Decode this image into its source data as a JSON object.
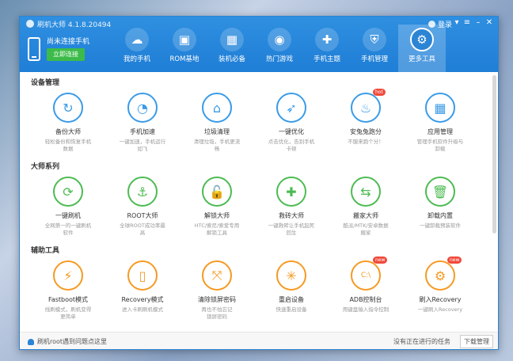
{
  "window": {
    "title": "刷机大师 4.1.8.20494",
    "login": "登录"
  },
  "phone": {
    "status": "尚未连接手机",
    "connect_label": "立即连接"
  },
  "nav": [
    {
      "label": "我的手机",
      "icon": "cloud-icon",
      "color": "#4aa3e8"
    },
    {
      "label": "ROM基地",
      "icon": "shopping-bag-icon",
      "color": "#ffffff"
    },
    {
      "label": "装机必备",
      "icon": "picture-icon",
      "color": "#f0a030"
    },
    {
      "label": "热门游戏",
      "icon": "gamepad-icon",
      "color": "#f58a1f"
    },
    {
      "label": "手机主题",
      "icon": "tshirt-icon",
      "color": "#e8453c"
    },
    {
      "label": "手机管理",
      "icon": "shield-icon",
      "color": "#3db14e"
    },
    {
      "label": "更多工具",
      "icon": "tools-icon",
      "color": "#2b84d4"
    }
  ],
  "sections": [
    {
      "title": "设备管理",
      "tools": [
        {
          "name": "备份大师",
          "desc1": "轻松备份和恢复手机",
          "desc2": "数据",
          "icon": "backup-icon",
          "badge": ""
        },
        {
          "name": "手机加速",
          "desc1": "一键加速，手机运行",
          "desc2": "如飞",
          "icon": "speedometer-icon",
          "badge": ""
        },
        {
          "name": "垃圾清理",
          "desc1": "清理垃圾，手机更流",
          "desc2": "畅",
          "icon": "broom-icon",
          "badge": ""
        },
        {
          "name": "一键优化",
          "desc1": "点击优化，告别手机",
          "desc2": "卡顿",
          "icon": "rocket-icon",
          "badge": ""
        },
        {
          "name": "安兔兔跑分",
          "desc1": "不服来跑个分！",
          "desc2": "",
          "icon": "antutu-icon",
          "badge": "hot"
        },
        {
          "name": "应用管理",
          "desc1": "管理手机软件升级与",
          "desc2": "卸载",
          "icon": "apps-icon",
          "badge": ""
        }
      ]
    },
    {
      "title": "大师系列",
      "tools": [
        {
          "name": "一键刷机",
          "desc1": "全网第一的一键刷机",
          "desc2": "软件",
          "icon": "refresh-icon",
          "badge": ""
        },
        {
          "name": "ROOT大师",
          "desc1": "全球ROOT成功率最",
          "desc2": "高",
          "icon": "anchor-icon",
          "badge": ""
        },
        {
          "name": "解锁大师",
          "desc1": "HTC/索尼/索爱专用",
          "desc2": "解锁工具",
          "icon": "unlock-icon",
          "badge": ""
        },
        {
          "name": "救砖大师",
          "desc1": "一键救砖让手机起死",
          "desc2": "回生",
          "icon": "phone-rescue-icon",
          "badge": ""
        },
        {
          "name": "搬家大师",
          "desc1": "酷派/MTK/安卓数据",
          "desc2": "搬家",
          "icon": "move-icon",
          "badge": ""
        },
        {
          "name": "卸载内置",
          "desc1": "一键卸载预装软件",
          "desc2": "",
          "icon": "trash-icon",
          "badge": ""
        }
      ]
    },
    {
      "title": "辅助工具",
      "tools": [
        {
          "name": "Fastboot模式",
          "desc1": "线刷模式，刷机变得",
          "desc2": "更简单",
          "icon": "lightning-icon",
          "badge": ""
        },
        {
          "name": "Recovery模式",
          "desc1": "进入卡刷刷机模式",
          "desc2": "",
          "icon": "recovery-icon",
          "badge": ""
        },
        {
          "name": "清除锁屏密码",
          "desc1": "再也不怕忘记",
          "desc2": "锁屏密码",
          "icon": "pattern-lock-icon",
          "badge": ""
        },
        {
          "name": "重启设备",
          "desc1": "快速重启设备",
          "desc2": "",
          "icon": "restart-icon",
          "badge": ""
        },
        {
          "name": "ADB控制台",
          "desc1": "用键盘输入指令控制",
          "desc2": "",
          "icon": "terminal-icon",
          "badge": "new"
        },
        {
          "name": "刷入Recovery",
          "desc1": "一键刷入Recovery",
          "desc2": "",
          "icon": "flash-recovery-icon",
          "badge": "new"
        }
      ]
    }
  ],
  "footer": {
    "help": "刷机root遇到问题点这里",
    "task": "没有正在进行的任务",
    "download": "下载管理"
  }
}
